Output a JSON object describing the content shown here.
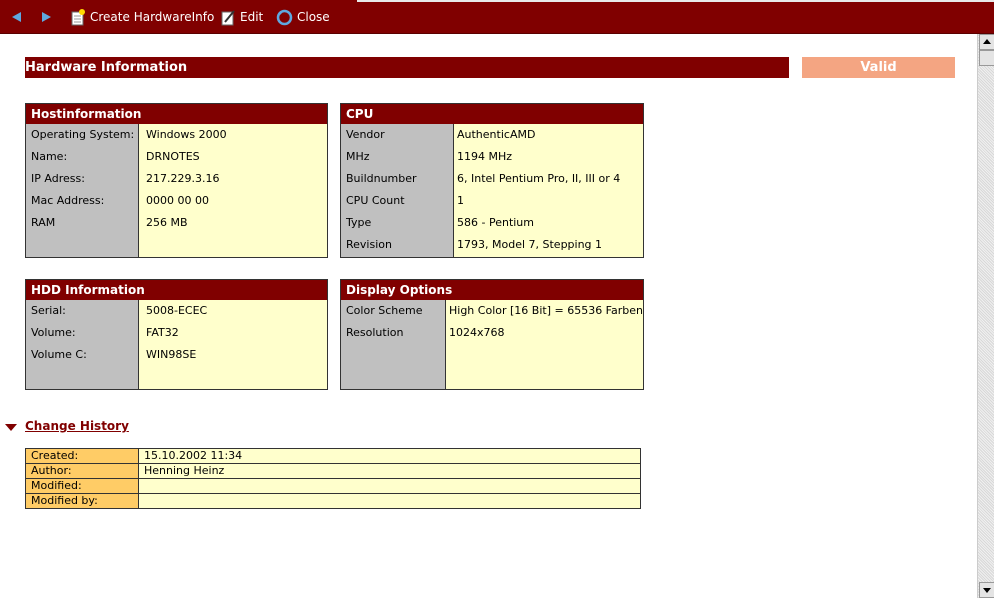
{
  "toolbar": {
    "back_icon": "back-arrow-icon",
    "forward_icon": "forward-arrow-icon",
    "create_label": "Create HardwareInfo",
    "edit_label": "Edit",
    "close_label": "Close"
  },
  "page": {
    "title": "Hardware Information",
    "status": "Valid"
  },
  "hostinfo": {
    "header": "Hostinformation",
    "rows": [
      {
        "label": "Operating System:",
        "value": "Windows 2000"
      },
      {
        "label": "Name:",
        "value": "DRNOTES"
      },
      {
        "label": "IP Adress:",
        "value": "217.229.3.16"
      },
      {
        "label": "Mac Address:",
        "value": "0000 00 00"
      },
      {
        "label": "RAM",
        "value": "256 MB"
      }
    ]
  },
  "cpu": {
    "header": "CPU",
    "rows": [
      {
        "label": "Vendor",
        "value": "AuthenticAMD"
      },
      {
        "label": "MHz",
        "value": "1194 MHz"
      },
      {
        "label": "Buildnumber",
        "value": "6, Intel Pentium Pro, II, III or 4"
      },
      {
        "label": "CPU Count",
        "value": "1"
      },
      {
        "label": "Type",
        "value": "586 - Pentium"
      },
      {
        "label": "Revision",
        "value": "1793, Model 7, Stepping 1"
      }
    ]
  },
  "hdd": {
    "header": "HDD Information",
    "rows": [
      {
        "label": "Serial:",
        "value": "5008-ECEC"
      },
      {
        "label": "Volume:",
        "value": "FAT32"
      },
      {
        "label": "Volume C:",
        "value": "WIN98SE"
      }
    ]
  },
  "display": {
    "header": "Display Options",
    "rows": [
      {
        "label": "Color Scheme",
        "value": "High Color [16 Bit] = 65536 Farben"
      },
      {
        "label": "Resolution",
        "value": "1024x768"
      }
    ]
  },
  "history": {
    "link_label": "Change History",
    "rows": [
      {
        "label": "Created:",
        "value": "15.10.2002 11:34"
      },
      {
        "label": "Author:",
        "value": "Henning Heinz"
      },
      {
        "label": "Modified:",
        "value": ""
      },
      {
        "label": "Modified by:",
        "value": ""
      }
    ]
  },
  "colors": {
    "brand": "#800000",
    "panel_bg": "#ffffcc",
    "label_bg": "#c0c0c0",
    "history_label_bg": "#ffcc66",
    "valid_bg": "#f4a582"
  }
}
